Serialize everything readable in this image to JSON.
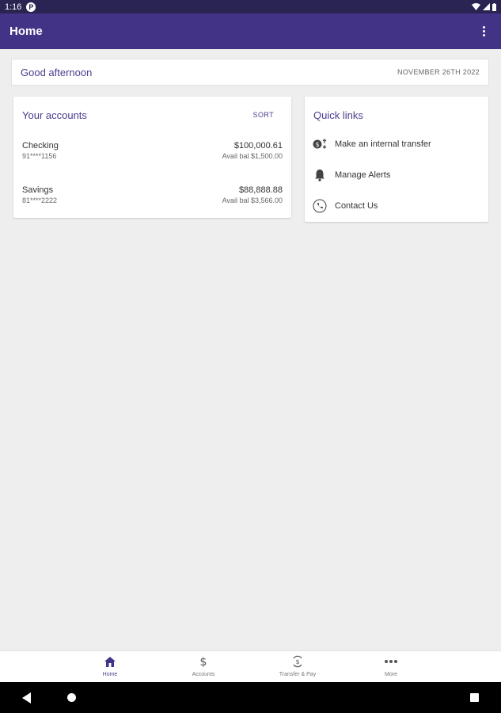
{
  "status_bar": {
    "time": "1:16",
    "notification_icon": "P"
  },
  "app_bar": {
    "title": "Home"
  },
  "greeting": {
    "text": "Good afternoon",
    "date": "NOVEMBER 26TH 2022"
  },
  "accounts": {
    "title": "Your accounts",
    "sort_label": "SORT",
    "items": [
      {
        "name": "Checking",
        "number": "91****1156",
        "balance": "$100,000.61",
        "available": "Avail bal $1,500.00"
      },
      {
        "name": "Savings",
        "number": "81****2222",
        "balance": "$88,888.88",
        "available": "Avail bal $3,566.00"
      }
    ]
  },
  "quick_links": {
    "title": "Quick links",
    "items": [
      {
        "label": "Make an internal transfer",
        "icon": "transfer-icon"
      },
      {
        "label": "Manage Alerts",
        "icon": "bell-icon"
      },
      {
        "label": "Contact Us",
        "icon": "phone-icon"
      }
    ]
  },
  "bottom_nav": {
    "items": [
      {
        "label": "Home",
        "icon": "home-icon",
        "active": true
      },
      {
        "label": "Accounts",
        "icon": "dollar-icon"
      },
      {
        "label": "Transfer & Pay",
        "icon": "transfer-pay-icon"
      },
      {
        "label": "More",
        "icon": "more-icon"
      }
    ]
  },
  "colors": {
    "primary": "#433386",
    "status_bar": "#2a2453",
    "accent_text": "#4a3d8e",
    "background": "#eeeeee"
  }
}
